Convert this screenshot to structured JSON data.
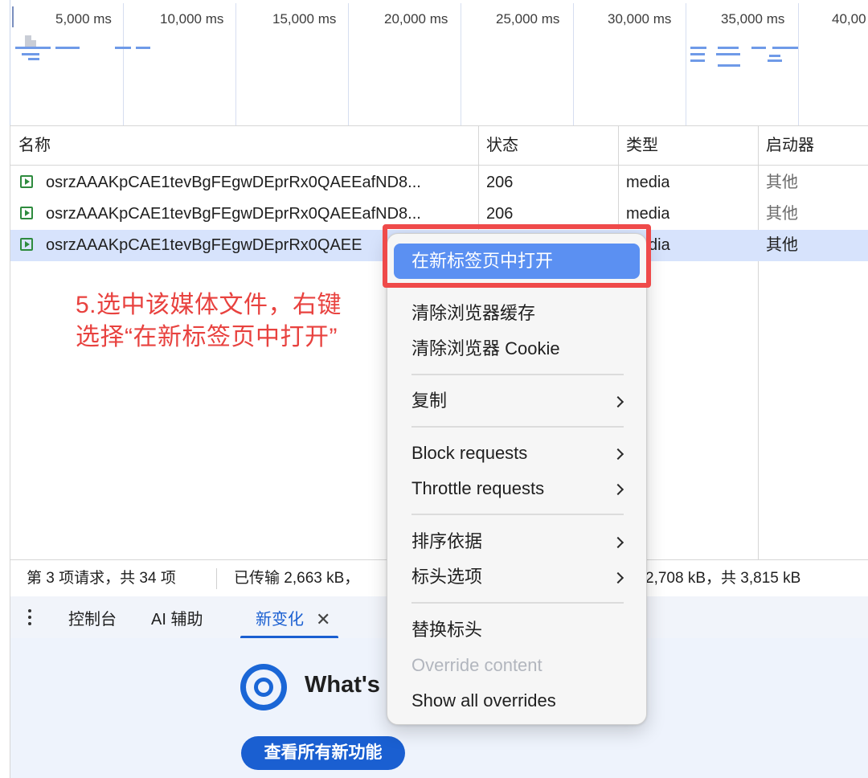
{
  "timeline": {
    "ticks": [
      "5,000 ms",
      "10,000 ms",
      "15,000 ms",
      "20,000 ms",
      "25,000 ms",
      "30,000 ms",
      "35,000 ms",
      "40,00"
    ]
  },
  "table": {
    "headers": [
      "名称",
      "状态",
      "类型",
      "启动器"
    ],
    "rows": [
      {
        "name": "osrzAAAKpCAE1tevBgFEgwDEprRx0QAEEafND8...",
        "status": "206",
        "type": "media",
        "initiator": "其他"
      },
      {
        "name": "osrzAAAKpCAE1tevBgFEgwDEprRx0QAEEafND8...",
        "status": "206",
        "type": "media",
        "initiator": "其他"
      },
      {
        "name": "osrzAAAKpCAE1tevBgFEgwDEprRx0QAEE",
        "status": "",
        "type": "dia",
        "initiator": "其他"
      }
    ]
  },
  "statusbar": {
    "requests": "第 3 项请求，共 34 项",
    "transferred": "已传输 2,663 kB，",
    "resources": "2,708 kB，共 3,815 kB"
  },
  "drawer": {
    "tabs": [
      "控制台",
      "AI 辅助",
      "新变化"
    ],
    "close": "✕",
    "whats_new": "What's",
    "button": "查看所有新功能"
  },
  "annotation": {
    "line1": "5.选中该媒体文件，右键",
    "line2": "选择“在新标签页中打开”"
  },
  "menu": {
    "open_new_tab": "在新标签页中打开",
    "clear_cache": "清除浏览器缓存",
    "clear_cookie": "清除浏览器 Cookie",
    "copy": "复制",
    "block_requests": "Block requests",
    "throttle_requests": "Throttle requests",
    "sort_by": "排序依据",
    "header_options": "标头选项",
    "override_headers": "替换标头",
    "override_content": "Override content",
    "show_all_overrides": "Show all overrides"
  },
  "colors": {
    "highlight": "#5b90f2",
    "annotation": "#e8423f",
    "accent": "#1a5fd1",
    "media_icon": "#2e8b3e",
    "selected_row": "#d7e3fc"
  }
}
